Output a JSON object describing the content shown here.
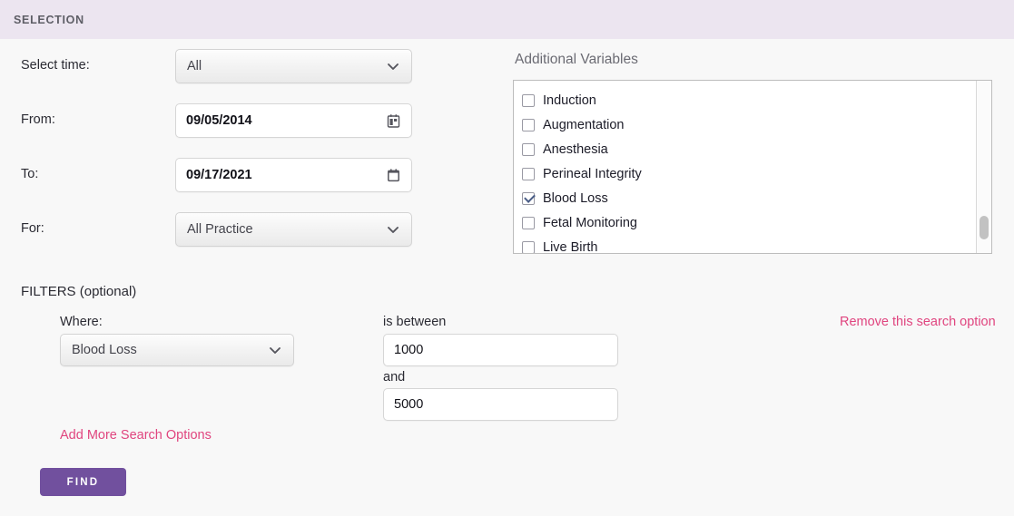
{
  "section": {
    "header_title": "SELECTION"
  },
  "selection": {
    "labels": {
      "select_time": "Select time:",
      "from": "From:",
      "to": "To:",
      "for": "For:"
    },
    "select_time": {
      "value": "All",
      "icon": "chevron-down-icon"
    },
    "from": {
      "value": "09/05/2014",
      "icon": "calendar-icon"
    },
    "to": {
      "value": "09/17/2021",
      "icon": "calendar-icon"
    },
    "for": {
      "value": "All Practice",
      "icon": "chevron-down-icon"
    }
  },
  "additional_variables": {
    "title": "Additional Variables",
    "items": [
      {
        "label": "Induction",
        "checked": false
      },
      {
        "label": "Augmentation",
        "checked": false
      },
      {
        "label": "Anesthesia",
        "checked": false
      },
      {
        "label": "Perineal Integrity",
        "checked": false
      },
      {
        "label": "Blood Loss",
        "checked": true
      },
      {
        "label": "Fetal Monitoring",
        "checked": false
      },
      {
        "label": "Live Birth",
        "checked": false
      }
    ]
  },
  "filters": {
    "title": "FILTERS (optional)",
    "where_label": "Where:",
    "where_value": "Blood Loss",
    "is_between_label": "is between",
    "min_value": "1000",
    "and_label": "and",
    "max_value": "5000",
    "remove_link": "Remove this search option",
    "add_link": "Add More Search Options"
  },
  "actions": {
    "find_label": "FIND"
  },
  "colors": {
    "header_bg": "#ece5f0",
    "accent_pink": "#e0457f",
    "button_purple": "#71509e",
    "page_bg": "#f8f8f8"
  }
}
